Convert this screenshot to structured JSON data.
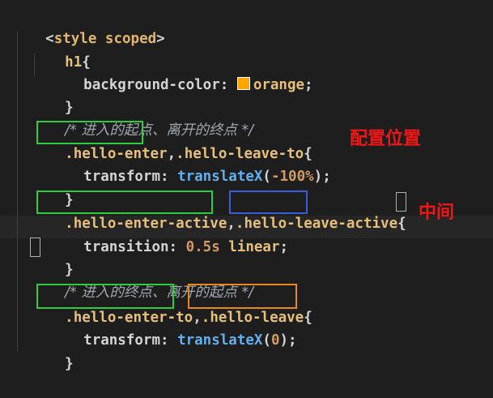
{
  "code": {
    "line1_open": "<",
    "line1_tag": "style",
    "line1_attr": " scoped",
    "line1_close": ">",
    "line2_selector": "h1",
    "line2_brace": "{",
    "line3_prop": "background-color: ",
    "line3_value": "orange",
    "line3_semicolon": ";",
    "close_brace": "}",
    "comment1": "/* 进入的起点、离开的终点 */",
    "line6_dot1": ".",
    "line6_sel1": "hello-enter",
    "line6_comma": ",",
    "line6_sel2": ".hello-leave-to",
    "line6_brace": "{",
    "line7_prop": "transform: ",
    "line7_fn": "translateX",
    "line7_open": "(",
    "line7_num": "-100%",
    "line7_end": ");",
    "line9_dot1": ".",
    "line9_sel1": "hello-enter-active",
    "line9_comma": ",",
    "line9_dot2": ".",
    "line9_sel2": "hello-leave-active",
    "line9_brace": "{",
    "line10_prop": "transition: ",
    "line10_num": "0.5s",
    "line10_val": " linear",
    "line10_semicolon": ";",
    "comment2": "/* 进入的终点、离开的起点 */",
    "line13_dot1": ".",
    "line13_sel1": "hello-enter-to",
    "line13_comma": ",",
    "line13_dot2": ".",
    "line13_sel2": "hello-leave",
    "line13_brace": "{",
    "line14_prop": "transform: ",
    "line14_fn": "translateX",
    "line14_open": "(",
    "line14_num": "0",
    "line14_end": ");"
  },
  "annotations": {
    "note1": "配置位置",
    "note2": "中间"
  },
  "colors": {
    "swatch": "#ffa500",
    "highlight_green": "#2ecc40",
    "highlight_blue": "#3a5cd8",
    "highlight_orange": "#e8891c",
    "note_red": "#f01616"
  }
}
